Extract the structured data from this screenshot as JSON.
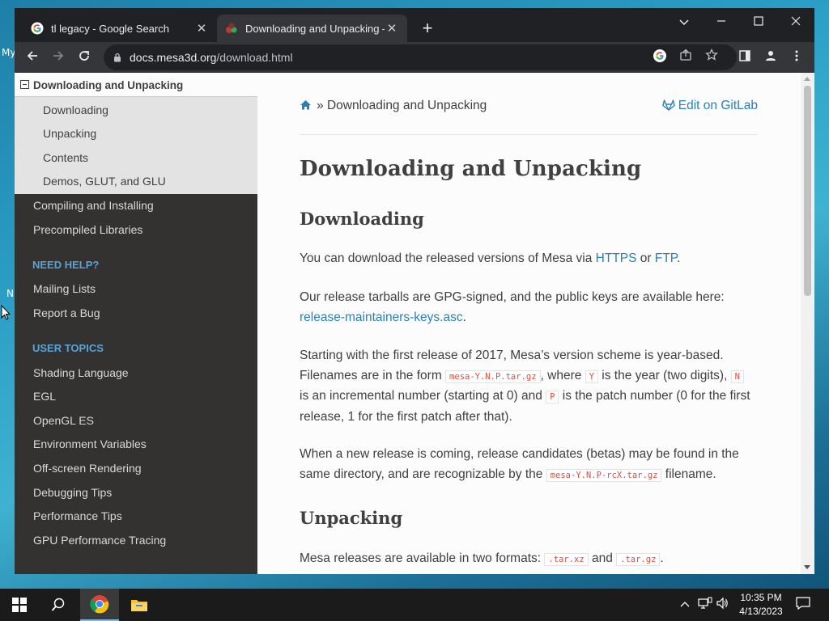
{
  "desktop": {
    "fragments": [
      "My",
      "N"
    ]
  },
  "browser": {
    "tabs": [
      {
        "title": "tl legacy - Google Search",
        "active": false
      },
      {
        "title": "Downloading and Unpacking —",
        "active": true
      }
    ],
    "new_tab": "+",
    "url_host": "docs.mesa3d.org",
    "url_path": "/download.html"
  },
  "sidebar": {
    "current": "Downloading and Unpacking",
    "subitems": [
      "Downloading",
      "Unpacking",
      "Contents",
      "Demos, GLUT, and GLU"
    ],
    "items_top": [
      "Compiling and Installing",
      "Precompiled Libraries"
    ],
    "need_help_caption": "NEED HELP?",
    "help_items": [
      "Mailing Lists",
      "Report a Bug"
    ],
    "user_topics_caption": "USER TOPICS",
    "topic_items": [
      "Shading Language",
      "EGL",
      "OpenGL ES",
      "Environment Variables",
      "Off-screen Rendering",
      "Debugging Tips",
      "Performance Tips",
      "GPU Performance Tracing"
    ]
  },
  "content": {
    "breadcrumb_sep": "»",
    "breadcrumb_current": "Downloading and Unpacking",
    "edit_link": "Edit on GitLab",
    "h1": "Downloading and Unpacking",
    "h2_downloading": "Downloading",
    "p1_a": "You can download the released versions of Mesa via ",
    "p1_https": "HTTPS",
    "p1_b": " or ",
    "p1_ftp": "FTP",
    "p1_c": ".",
    "p2_a": "Our release tarballs are GPG-signed, and the public keys are available here: ",
    "p2_link": "release-maintainers-keys.asc",
    "p2_b": ".",
    "p3_a": "Starting with the first release of 2017, Mesa’s version scheme is year-based. Filenames are in the form ",
    "p3_code1": "mesa-Y.N.P.tar.gz",
    "p3_b": ", where ",
    "p3_code2": "Y",
    "p3_c": " is the year (two digits), ",
    "p3_code3": "N",
    "p3_d": " is an incremental number (starting at 0) and ",
    "p3_code4": "P",
    "p3_e": " is the patch number (0 for the first release, 1 for the first patch after that).",
    "p4_a": "When a new release is coming, release candidates (betas) may be found in the same directory, and are recognizable by the ",
    "p4_code": "mesa-Y.N.P-rcX.tar.gz",
    "p4_b": " filename.",
    "h2_unpacking": "Unpacking",
    "p5_a": "Mesa releases are available in two formats: ",
    "p5_code1": ".tar.xz",
    "p5_b": " and ",
    "p5_code2": ".tar.gz",
    "p5_c": "."
  },
  "taskbar": {
    "time": "10:35 PM",
    "date": "4/13/2023"
  },
  "colors": {
    "sidebar_bg": "#343131",
    "link": "#2980b9",
    "caption": "#55a5d9",
    "code": "#e74c3c"
  }
}
